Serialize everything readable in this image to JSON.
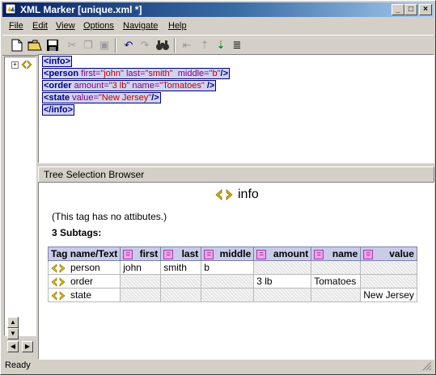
{
  "window": {
    "title": "XML Marker  [unique.xml *]",
    "buttons": {
      "minimize": "_",
      "maximize": "□",
      "close": "×"
    }
  },
  "menu": [
    {
      "label": "File",
      "key": "F"
    },
    {
      "label": "Edit",
      "key": "E"
    },
    {
      "label": "View",
      "key": "V"
    },
    {
      "label": "Options",
      "key": "O"
    },
    {
      "label": "Navigate",
      "key": "N"
    },
    {
      "label": "Help",
      "key": "H"
    }
  ],
  "toolbar": {
    "icons": [
      "new-file-icon",
      "open-folder-icon",
      "save-icon",
      "cut-icon",
      "copy-icon",
      "paste-icon",
      "undo-icon",
      "redo-icon",
      "find-icon",
      "indent-icon",
      "move-up-icon",
      "move-down-icon",
      "format-icon"
    ]
  },
  "tree": {
    "expander": "+",
    "node_icon": "xml-tag-icon"
  },
  "xml_source": [
    {
      "tag": "<info>"
    },
    {
      "tag": "<person",
      "attrs": [
        {
          "name": " first=",
          "value": "\"john\""
        },
        {
          "name": " last=",
          "value": "\"smith\""
        },
        {
          "name": "  middle=",
          "value": "\"b\""
        }
      ],
      "close": "/>"
    },
    {
      "tag": "<order",
      "attrs": [
        {
          "name": " amount=",
          "value": "\"3 lb\""
        },
        {
          "name": " name=",
          "value": "\"Tomatoes\""
        }
      ],
      "close": " />"
    },
    {
      "tag": "<state",
      "attrs": [
        {
          "name": " value=",
          "value": "\"New Jersey\""
        }
      ],
      "close": "/>"
    },
    {
      "tag": "</info>"
    }
  ],
  "browser": {
    "header": "Tree Selection Browser",
    "selected_tag": "info",
    "no_attributes_text": "(This tag has no attibutes.)",
    "subtags_label": "3 Subtags:",
    "columns": [
      "Tag name/Text",
      "first",
      "last",
      "middle",
      "amount",
      "name",
      "value"
    ],
    "eq_symbol": "=",
    "rows": [
      {
        "tag": "person",
        "cells": [
          "john",
          "smith",
          "b",
          "",
          "",
          ""
        ]
      },
      {
        "tag": "order",
        "cells": [
          "",
          "",
          "",
          "3 lb",
          "Tomatoes",
          ""
        ]
      },
      {
        "tag": "state",
        "cells": [
          "",
          "",
          "",
          "",
          "",
          "New Jersey"
        ]
      }
    ]
  },
  "status": {
    "text": "Ready"
  }
}
